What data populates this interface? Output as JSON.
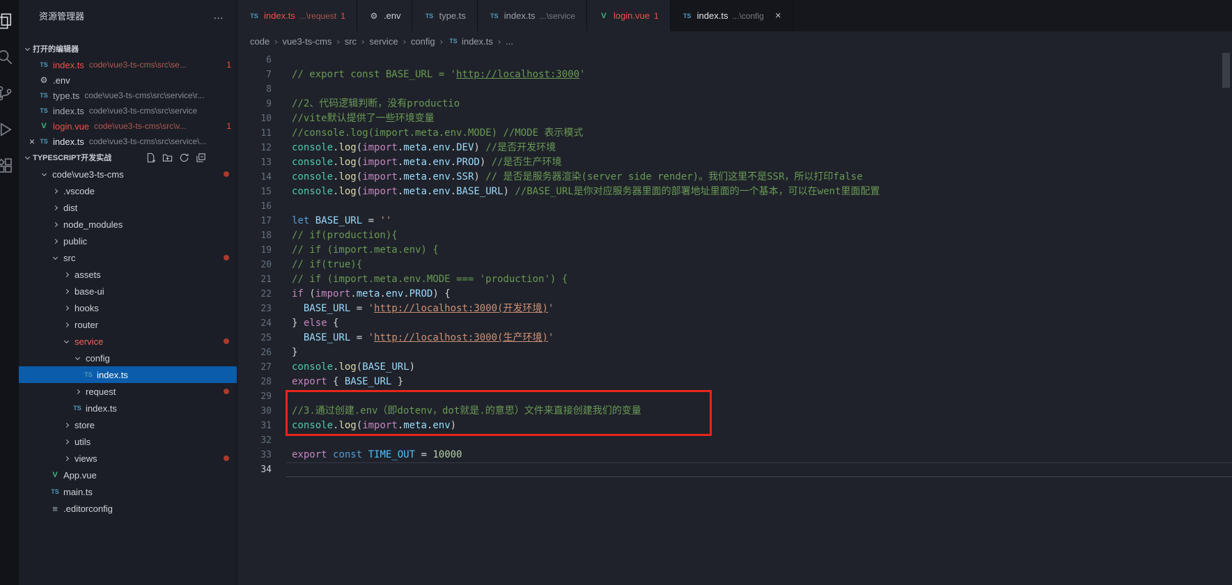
{
  "colors": {
    "accent": "#0b5cab",
    "error": "#f25048",
    "modified_dot": "#a83a2e",
    "annotation": "#e8251c"
  },
  "activity_bar": {
    "icons": [
      {
        "name": "files-icon"
      },
      {
        "name": "search-icon"
      },
      {
        "name": "source-control-icon"
      },
      {
        "name": "run-debug-icon"
      },
      {
        "name": "extensions-icon"
      }
    ]
  },
  "sidebar": {
    "title": "资源管理器",
    "more_label": "…",
    "open_editors": {
      "header": "打开的编辑器",
      "items": [
        {
          "icon": "ts",
          "name": "index.ts",
          "path": "code\\vue3-ts-cms\\src\\se...",
          "badge": "1",
          "color": "error"
        },
        {
          "icon": "gear",
          "name": ".env",
          "path": "",
          "color": "light"
        },
        {
          "icon": "ts",
          "name": "type.ts",
          "path": "code\\vue3-ts-cms\\src\\service\\r...",
          "color": "dim"
        },
        {
          "icon": "ts",
          "name": "index.ts",
          "path": "code\\vue3-ts-cms\\src\\service",
          "color": "dim"
        },
        {
          "icon": "vue",
          "name": "login.vue",
          "path": "code\\vue3-ts-cms\\src\\v...",
          "badge": "1",
          "color": "error"
        },
        {
          "icon": "ts",
          "name": "index.ts",
          "path": "code\\vue3-ts-cms\\src\\service\\...",
          "color": "active",
          "close": true
        }
      ]
    },
    "project": {
      "header": "TYPESCRIPT开发实战",
      "actions": [
        "new-file",
        "new-folder",
        "refresh",
        "collapse-all"
      ],
      "tree": [
        {
          "label": "code\\vue3-ts-cms",
          "indent": 0,
          "kind": "folder",
          "expanded": true,
          "dot": true
        },
        {
          "label": ".vscode",
          "indent": 1,
          "kind": "folder"
        },
        {
          "label": "dist",
          "indent": 1,
          "kind": "folder"
        },
        {
          "label": "node_modules",
          "indent": 1,
          "kind": "folder"
        },
        {
          "label": "public",
          "indent": 1,
          "kind": "folder"
        },
        {
          "label": "src",
          "indent": 1,
          "kind": "folder",
          "expanded": true,
          "dot": true
        },
        {
          "label": "assets",
          "indent": 2,
          "kind": "folder"
        },
        {
          "label": "base-ui",
          "indent": 2,
          "kind": "folder"
        },
        {
          "label": "hooks",
          "indent": 2,
          "kind": "folder"
        },
        {
          "label": "router",
          "indent": 2,
          "kind": "folder"
        },
        {
          "label": "service",
          "indent": 2,
          "kind": "folder",
          "expanded": true,
          "dot": true,
          "color": "error"
        },
        {
          "label": "config",
          "indent": 3,
          "kind": "folder",
          "expanded": true
        },
        {
          "label": "index.ts",
          "indent": 4,
          "kind": "ts",
          "selected": true
        },
        {
          "label": "request",
          "indent": 3,
          "kind": "folder",
          "dot": true
        },
        {
          "label": "index.ts",
          "indent": 3,
          "kind": "ts"
        },
        {
          "label": "store",
          "indent": 2,
          "kind": "folder"
        },
        {
          "label": "utils",
          "indent": 2,
          "kind": "folder"
        },
        {
          "label": "views",
          "indent": 2,
          "kind": "folder",
          "dot": true
        },
        {
          "label": "App.vue",
          "indent": 1,
          "kind": "vue"
        },
        {
          "label": "main.ts",
          "indent": 1,
          "kind": "ts"
        },
        {
          "label": ".editorconfig",
          "indent": 1,
          "kind": "editorconfig"
        }
      ]
    }
  },
  "tabs": [
    {
      "icon": "ts",
      "name": "index.ts",
      "detail": "...\\request",
      "badge": "1",
      "color": "error"
    },
    {
      "icon": "gear",
      "name": ".env",
      "color": "light"
    },
    {
      "icon": "ts",
      "name": "type.ts"
    },
    {
      "icon": "ts",
      "name": "index.ts",
      "detail": "...\\service"
    },
    {
      "icon": "vue",
      "name": "login.vue",
      "badge": "1",
      "color": "error"
    },
    {
      "icon": "ts",
      "name": "index.ts",
      "detail": "...\\config",
      "active": true,
      "close": true
    }
  ],
  "breadcrumb": [
    {
      "label": "code"
    },
    {
      "label": "vue3-ts-cms"
    },
    {
      "label": "src"
    },
    {
      "label": "service"
    },
    {
      "label": "config"
    },
    {
      "label": "index.ts",
      "icon": "ts"
    },
    {
      "label": "..."
    }
  ],
  "editor": {
    "annotation": {
      "start": 30,
      "end": 31
    },
    "lines": [
      {
        "n": 6,
        "tokens": []
      },
      {
        "n": 7,
        "tokens": [
          [
            "cm",
            "// export const BASE_URL = '"
          ],
          [
            "cmu",
            "http://localhost:3000"
          ],
          [
            "cm",
            "'"
          ]
        ]
      },
      {
        "n": 8,
        "tokens": []
      },
      {
        "n": 9,
        "tokens": [
          [
            "cm",
            "//2、代码逻辑判断，没有productio"
          ]
        ]
      },
      {
        "n": 10,
        "tokens": [
          [
            "cm",
            "//vite默认提供了一些环境变量"
          ]
        ]
      },
      {
        "n": 11,
        "tokens": [
          [
            "cm",
            "//console.log(import.meta.env.MODE) //MODE 表示模式"
          ]
        ]
      },
      {
        "n": 12,
        "tokens": [
          [
            "cls",
            "console"
          ],
          [
            "pun",
            "."
          ],
          [
            "fn",
            "log"
          ],
          [
            "pun",
            "("
          ],
          [
            "kw",
            "import"
          ],
          [
            "pun",
            "."
          ],
          [
            "pr",
            "meta"
          ],
          [
            "pun",
            "."
          ],
          [
            "pr",
            "env"
          ],
          [
            "pun",
            "."
          ],
          [
            "pr",
            "DEV"
          ],
          [
            "pun",
            ") "
          ],
          [
            "cm",
            "//是否开发环境"
          ]
        ]
      },
      {
        "n": 13,
        "tokens": [
          [
            "cls",
            "console"
          ],
          [
            "pun",
            "."
          ],
          [
            "fn",
            "log"
          ],
          [
            "pun",
            "("
          ],
          [
            "kw",
            "import"
          ],
          [
            "pun",
            "."
          ],
          [
            "pr",
            "meta"
          ],
          [
            "pun",
            "."
          ],
          [
            "pr",
            "env"
          ],
          [
            "pun",
            "."
          ],
          [
            "pr",
            "PROD"
          ],
          [
            "pun",
            ") "
          ],
          [
            "cm",
            "//是否生产环境"
          ]
        ]
      },
      {
        "n": 14,
        "tokens": [
          [
            "cls",
            "console"
          ],
          [
            "pun",
            "."
          ],
          [
            "fn",
            "log"
          ],
          [
            "pun",
            "("
          ],
          [
            "kw",
            "import"
          ],
          [
            "pun",
            "."
          ],
          [
            "pr",
            "meta"
          ],
          [
            "pun",
            "."
          ],
          [
            "pr",
            "env"
          ],
          [
            "pun",
            "."
          ],
          [
            "pr",
            "SSR"
          ],
          [
            "pun",
            ") "
          ],
          [
            "cm",
            "// 是否是服务器渲染(server side render)。我们这里不是SSR，所以打印false"
          ]
        ]
      },
      {
        "n": 15,
        "tokens": [
          [
            "cls",
            "console"
          ],
          [
            "pun",
            "."
          ],
          [
            "fn",
            "log"
          ],
          [
            "pun",
            "("
          ],
          [
            "kw",
            "import"
          ],
          [
            "pun",
            "."
          ],
          [
            "pr",
            "meta"
          ],
          [
            "pun",
            "."
          ],
          [
            "pr",
            "env"
          ],
          [
            "pun",
            "."
          ],
          [
            "pr",
            "BASE_URL"
          ],
          [
            "pun",
            ") "
          ],
          [
            "cm",
            "//BASE_URL是你对应服务器里面的部署地址里面的一个基本，可以在went里面配置"
          ]
        ]
      },
      {
        "n": 16,
        "tokens": []
      },
      {
        "n": 17,
        "tokens": [
          [
            "st",
            "let"
          ],
          [
            "pun",
            " "
          ],
          [
            "pr",
            "BASE_URL"
          ],
          [
            "pun",
            " = "
          ],
          [
            "str",
            "''"
          ]
        ]
      },
      {
        "n": 18,
        "tokens": [
          [
            "cm",
            "// if(production){"
          ]
        ]
      },
      {
        "n": 19,
        "tokens": [
          [
            "cm",
            "// if (import.meta.env) {"
          ]
        ]
      },
      {
        "n": 20,
        "tokens": [
          [
            "cm",
            "// if(true){"
          ]
        ]
      },
      {
        "n": 21,
        "tokens": [
          [
            "cm",
            "// if (import.meta.env.MODE === 'production') {"
          ]
        ]
      },
      {
        "n": 22,
        "tokens": [
          [
            "kw",
            "if"
          ],
          [
            "pun",
            " ("
          ],
          [
            "kw",
            "import"
          ],
          [
            "pun",
            "."
          ],
          [
            "pr",
            "meta"
          ],
          [
            "pun",
            "."
          ],
          [
            "pr",
            "env"
          ],
          [
            "pun",
            "."
          ],
          [
            "pr",
            "PROD"
          ],
          [
            "pun",
            ") {"
          ]
        ]
      },
      {
        "n": 23,
        "tokens": [
          [
            "pun",
            "  "
          ],
          [
            "pr",
            "BASE_URL"
          ],
          [
            "pun",
            " = "
          ],
          [
            "str",
            "'"
          ],
          [
            "stru",
            "http://localhost:3000(开发环境)"
          ],
          [
            "str",
            "'"
          ]
        ]
      },
      {
        "n": 24,
        "tokens": [
          [
            "pun",
            "} "
          ],
          [
            "kw",
            "else"
          ],
          [
            "pun",
            " {"
          ]
        ]
      },
      {
        "n": 25,
        "tokens": [
          [
            "pun",
            "  "
          ],
          [
            "pr",
            "BASE_URL"
          ],
          [
            "pun",
            " = "
          ],
          [
            "str",
            "'"
          ],
          [
            "stru",
            "http://localhost:3000(生产环境)"
          ],
          [
            "str",
            "'"
          ]
        ]
      },
      {
        "n": 26,
        "tokens": [
          [
            "pun",
            "}"
          ]
        ]
      },
      {
        "n": 27,
        "tokens": [
          [
            "cls",
            "console"
          ],
          [
            "pun",
            "."
          ],
          [
            "fn",
            "log"
          ],
          [
            "pun",
            "("
          ],
          [
            "pr",
            "BASE_URL"
          ],
          [
            "pun",
            ")"
          ]
        ]
      },
      {
        "n": 28,
        "tokens": [
          [
            "kw",
            "export"
          ],
          [
            "pun",
            " { "
          ],
          [
            "pr",
            "BASE_URL"
          ],
          [
            "pun",
            " }"
          ]
        ]
      },
      {
        "n": 29,
        "tokens": []
      },
      {
        "n": 30,
        "tokens": [
          [
            "cm",
            "//3.通过创建.env（即dotenv，dot就是.的意思）文件来直接创建我们的变量"
          ]
        ]
      },
      {
        "n": 31,
        "tokens": [
          [
            "cls",
            "console"
          ],
          [
            "pun",
            "."
          ],
          [
            "fn",
            "log"
          ],
          [
            "pun",
            "("
          ],
          [
            "kw",
            "import"
          ],
          [
            "pun",
            "."
          ],
          [
            "pr",
            "meta"
          ],
          [
            "pun",
            "."
          ],
          [
            "pr",
            "env"
          ],
          [
            "pun",
            ")"
          ]
        ]
      },
      {
        "n": 32,
        "tokens": []
      },
      {
        "n": 33,
        "tokens": [
          [
            "kw",
            "export"
          ],
          [
            "pun",
            " "
          ],
          [
            "st",
            "const"
          ],
          [
            "pun",
            " "
          ],
          [
            "cn",
            "TIME_OUT"
          ],
          [
            "pun",
            " = "
          ],
          [
            "num",
            "10000"
          ]
        ]
      },
      {
        "n": 34,
        "tokens": [],
        "current": true
      }
    ]
  }
}
